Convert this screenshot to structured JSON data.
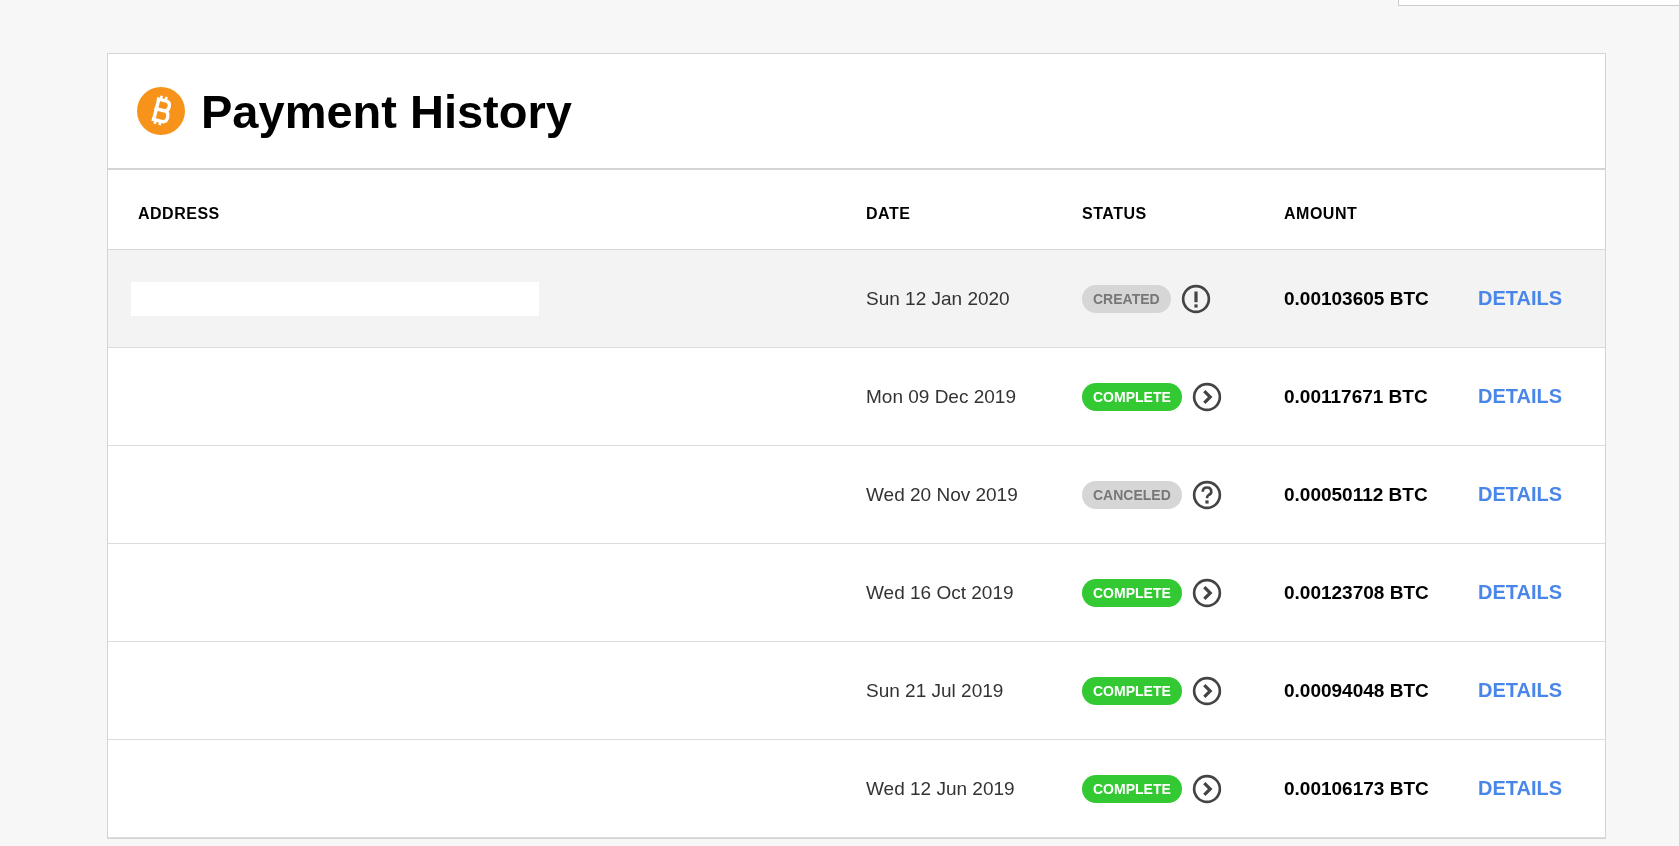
{
  "card": {
    "title": "Payment History"
  },
  "table": {
    "columns": [
      "ADDRESS",
      "DATE",
      "STATUS",
      "AMOUNT"
    ],
    "rows": [
      {
        "selected": true,
        "date": "Sun 12 Jan 2020",
        "status": {
          "label": "CREATED",
          "kind": "created"
        },
        "amount": "0.00103605 BTC",
        "action": "DETAILS"
      },
      {
        "selected": false,
        "date": "Mon 09 Dec 2019",
        "status": {
          "label": "COMPLETE",
          "kind": "complete"
        },
        "amount": "0.00117671 BTC",
        "action": "DETAILS"
      },
      {
        "selected": false,
        "date": "Wed 20 Nov 2019",
        "status": {
          "label": "CANCELED",
          "kind": "canceled"
        },
        "amount": "0.00050112 BTC",
        "action": "DETAILS"
      },
      {
        "selected": false,
        "date": "Wed 16 Oct 2019",
        "status": {
          "label": "COMPLETE",
          "kind": "complete"
        },
        "amount": "0.00123708 BTC",
        "action": "DETAILS"
      },
      {
        "selected": false,
        "date": "Sun 21 Jul 2019",
        "status": {
          "label": "COMPLETE",
          "kind": "complete"
        },
        "amount": "0.00094048 BTC",
        "action": "DETAILS"
      },
      {
        "selected": false,
        "date": "Wed 12 Jun 2019",
        "status": {
          "label": "COMPLETE",
          "kind": "complete"
        },
        "amount": "0.00106173 BTC",
        "action": "DETAILS"
      }
    ]
  }
}
